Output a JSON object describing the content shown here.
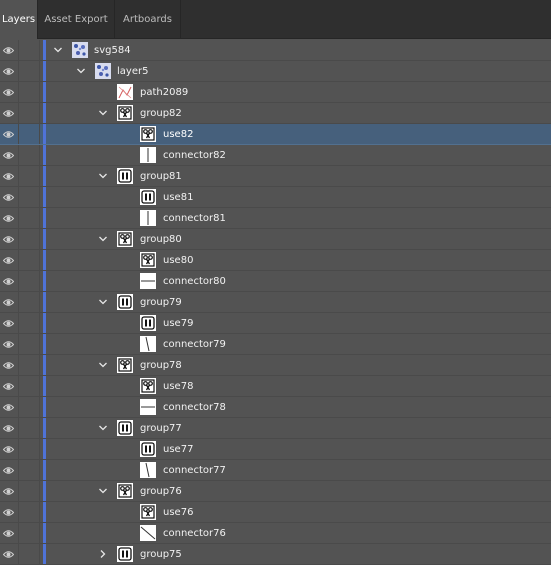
{
  "tabs": [
    {
      "label": "Layers",
      "active": true
    },
    {
      "label": "Asset Export",
      "active": false
    },
    {
      "label": "Artboards",
      "active": false
    }
  ],
  "layers": [
    {
      "name": "svg584",
      "depth": 0,
      "expander": "expanded",
      "thumb": "pattern"
    },
    {
      "name": "layer5",
      "depth": 1,
      "expander": "expanded",
      "thumb": "pattern"
    },
    {
      "name": "path2089",
      "depth": 2,
      "expander": "none",
      "thumb": "path"
    },
    {
      "name": "group82",
      "depth": 2,
      "expander": "expanded",
      "thumb": "scissors"
    },
    {
      "name": "use82",
      "depth": 3,
      "expander": "none",
      "thumb": "scissors",
      "selected": true
    },
    {
      "name": "connector82",
      "depth": 3,
      "expander": "none",
      "thumb": "vline"
    },
    {
      "name": "group81",
      "depth": 2,
      "expander": "expanded",
      "thumb": "pause"
    },
    {
      "name": "use81",
      "depth": 3,
      "expander": "none",
      "thumb": "pause"
    },
    {
      "name": "connector81",
      "depth": 3,
      "expander": "none",
      "thumb": "vline"
    },
    {
      "name": "group80",
      "depth": 2,
      "expander": "expanded",
      "thumb": "scissors"
    },
    {
      "name": "use80",
      "depth": 3,
      "expander": "none",
      "thumb": "scissors"
    },
    {
      "name": "connector80",
      "depth": 3,
      "expander": "none",
      "thumb": "hline"
    },
    {
      "name": "group79",
      "depth": 2,
      "expander": "expanded",
      "thumb": "pause"
    },
    {
      "name": "use79",
      "depth": 3,
      "expander": "none",
      "thumb": "pause"
    },
    {
      "name": "connector79",
      "depth": 3,
      "expander": "none",
      "thumb": "slant"
    },
    {
      "name": "group78",
      "depth": 2,
      "expander": "expanded",
      "thumb": "scissors"
    },
    {
      "name": "use78",
      "depth": 3,
      "expander": "none",
      "thumb": "scissors"
    },
    {
      "name": "connector78",
      "depth": 3,
      "expander": "none",
      "thumb": "hline"
    },
    {
      "name": "group77",
      "depth": 2,
      "expander": "expanded",
      "thumb": "pause"
    },
    {
      "name": "use77",
      "depth": 3,
      "expander": "none",
      "thumb": "pause"
    },
    {
      "name": "connector77",
      "depth": 3,
      "expander": "none",
      "thumb": "slant"
    },
    {
      "name": "group76",
      "depth": 2,
      "expander": "expanded",
      "thumb": "scissors"
    },
    {
      "name": "use76",
      "depth": 3,
      "expander": "none",
      "thumb": "scissors"
    },
    {
      "name": "connector76",
      "depth": 3,
      "expander": "none",
      "thumb": "diag"
    },
    {
      "name": "group75",
      "depth": 2,
      "expander": "collapsed",
      "thumb": "pause"
    }
  ],
  "colors": {
    "panel": "#535353",
    "tabbar": "#2f2f2f",
    "selection": "#46607c",
    "layer_color_bar": "#4f73d8"
  },
  "icons": {
    "visibility": "eye-icon",
    "expanded": "chevron-down-icon",
    "collapsed": "chevron-right-icon"
  }
}
